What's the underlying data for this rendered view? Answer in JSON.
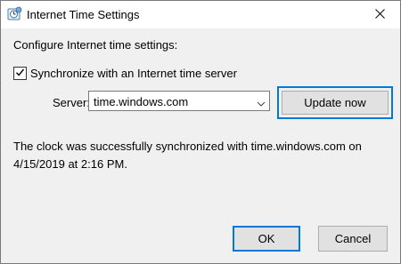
{
  "window": {
    "title": "Internet Time Settings",
    "icon": "clock-globe-icon"
  },
  "dialog": {
    "heading": "Configure Internet time settings:",
    "sync_label": "Synchronize with an Internet time server",
    "sync_checked": true,
    "server_label": "Server:",
    "server_value": "time.windows.com",
    "update_button": "Update now",
    "status_text": "The clock was successfully synchronized with time.windows.com on 4/15/2019 at 2:16 PM."
  },
  "footer": {
    "ok_label": "OK",
    "cancel_label": "Cancel"
  },
  "colors": {
    "accent": "#0078d7",
    "button_face": "#e1e1e1",
    "dialog_bg": "#f0f0f0"
  }
}
